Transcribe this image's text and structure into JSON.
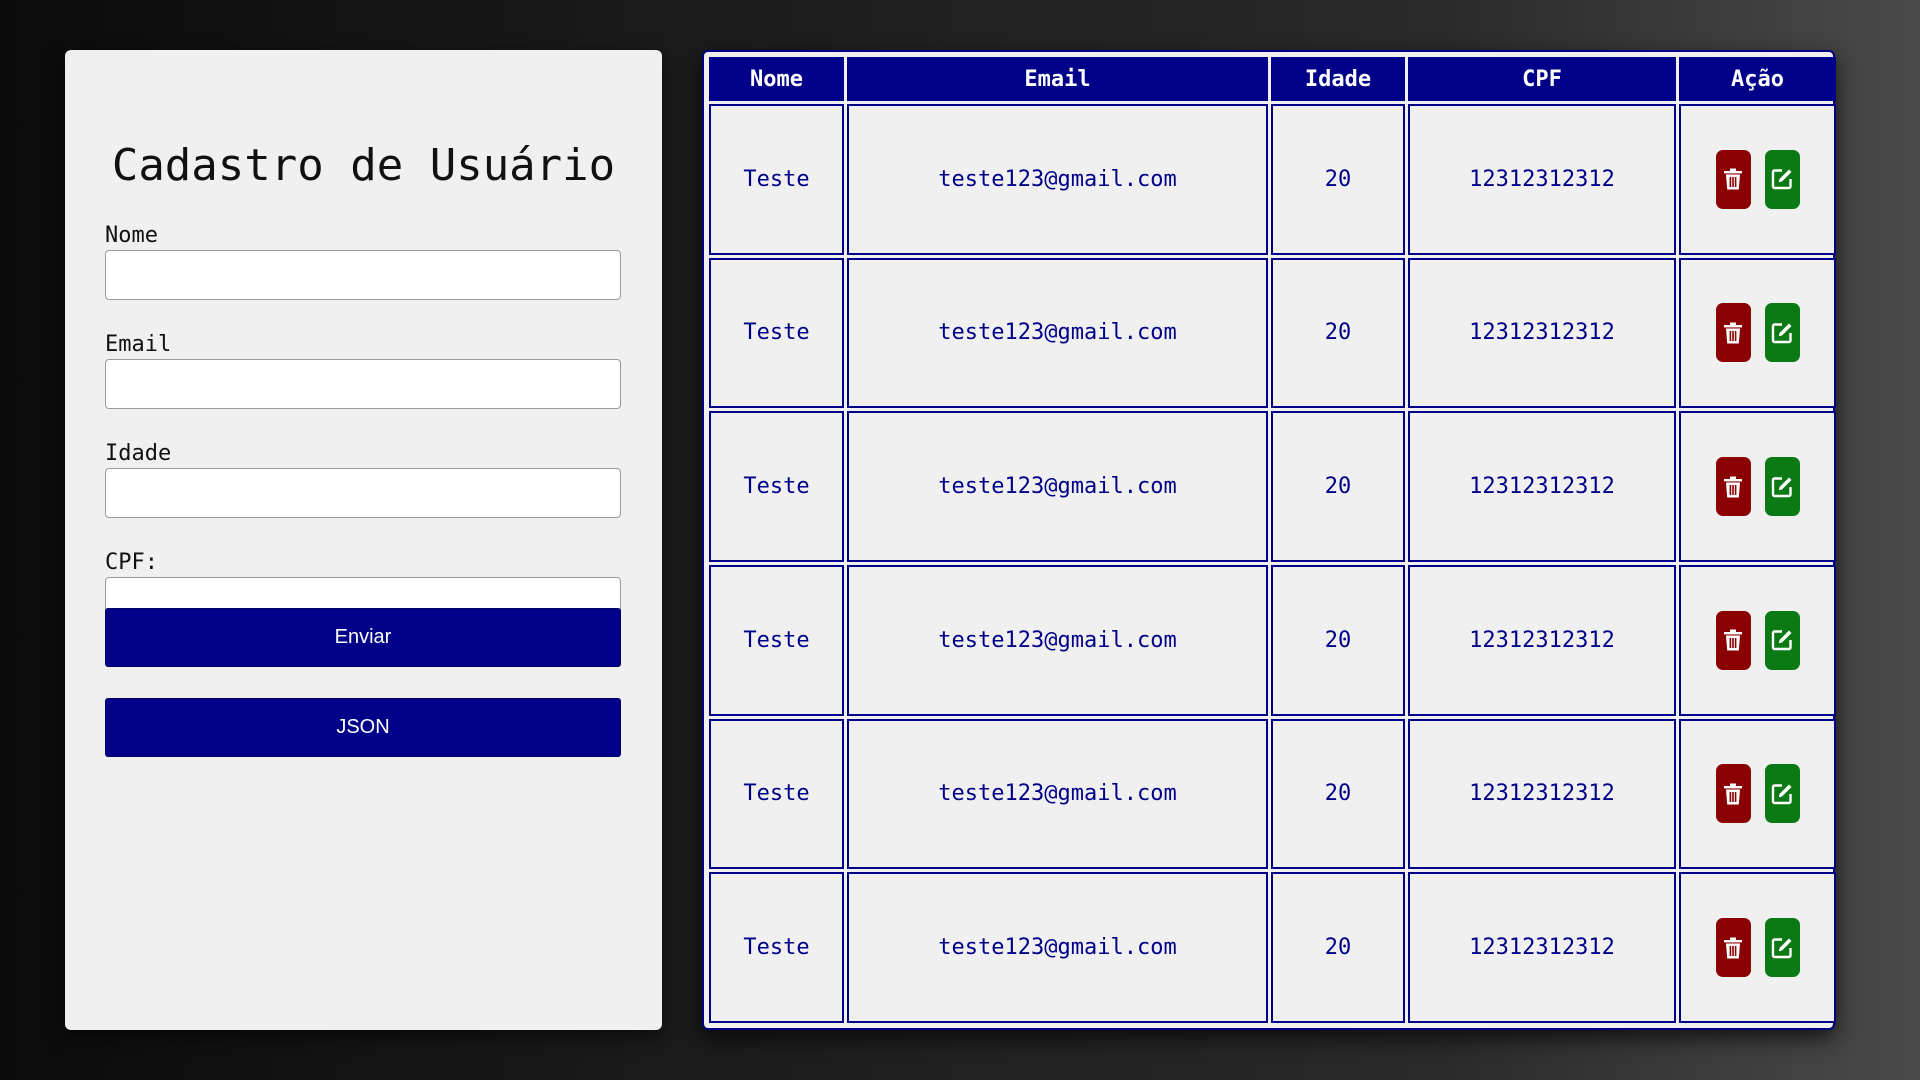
{
  "form": {
    "title": "Cadastro de Usuário",
    "fields": [
      {
        "label": "Nome",
        "value": "",
        "placeholder": ""
      },
      {
        "label": "Email",
        "value": "",
        "placeholder": ""
      },
      {
        "label": "Idade",
        "value": "",
        "placeholder": ""
      },
      {
        "label": "CPF:",
        "value": "",
        "placeholder": ""
      }
    ],
    "submit_label": "Enviar",
    "json_label": "JSON"
  },
  "table": {
    "headers": [
      "Nome",
      "Email",
      "Idade",
      "CPF",
      "Ação"
    ],
    "rows": [
      {
        "nome": "Teste",
        "email": "teste123@gmail.com",
        "idade": "20",
        "cpf": "12312312312"
      },
      {
        "nome": "Teste",
        "email": "teste123@gmail.com",
        "idade": "20",
        "cpf": "12312312312"
      },
      {
        "nome": "Teste",
        "email": "teste123@gmail.com",
        "idade": "20",
        "cpf": "12312312312"
      },
      {
        "nome": "Teste",
        "email": "teste123@gmail.com",
        "idade": "20",
        "cpf": "12312312312"
      },
      {
        "nome": "Teste",
        "email": "teste123@gmail.com",
        "idade": "20",
        "cpf": "12312312312"
      },
      {
        "nome": "Teste",
        "email": "teste123@gmail.com",
        "idade": "20",
        "cpf": "12312312312"
      }
    ],
    "actions": {
      "delete_icon": "trash-icon",
      "edit_icon": "edit-icon"
    }
  },
  "colors": {
    "primary": "#000088",
    "delete": "#8b0000",
    "edit": "#0b7a14",
    "panel": "#f0f0f0"
  }
}
